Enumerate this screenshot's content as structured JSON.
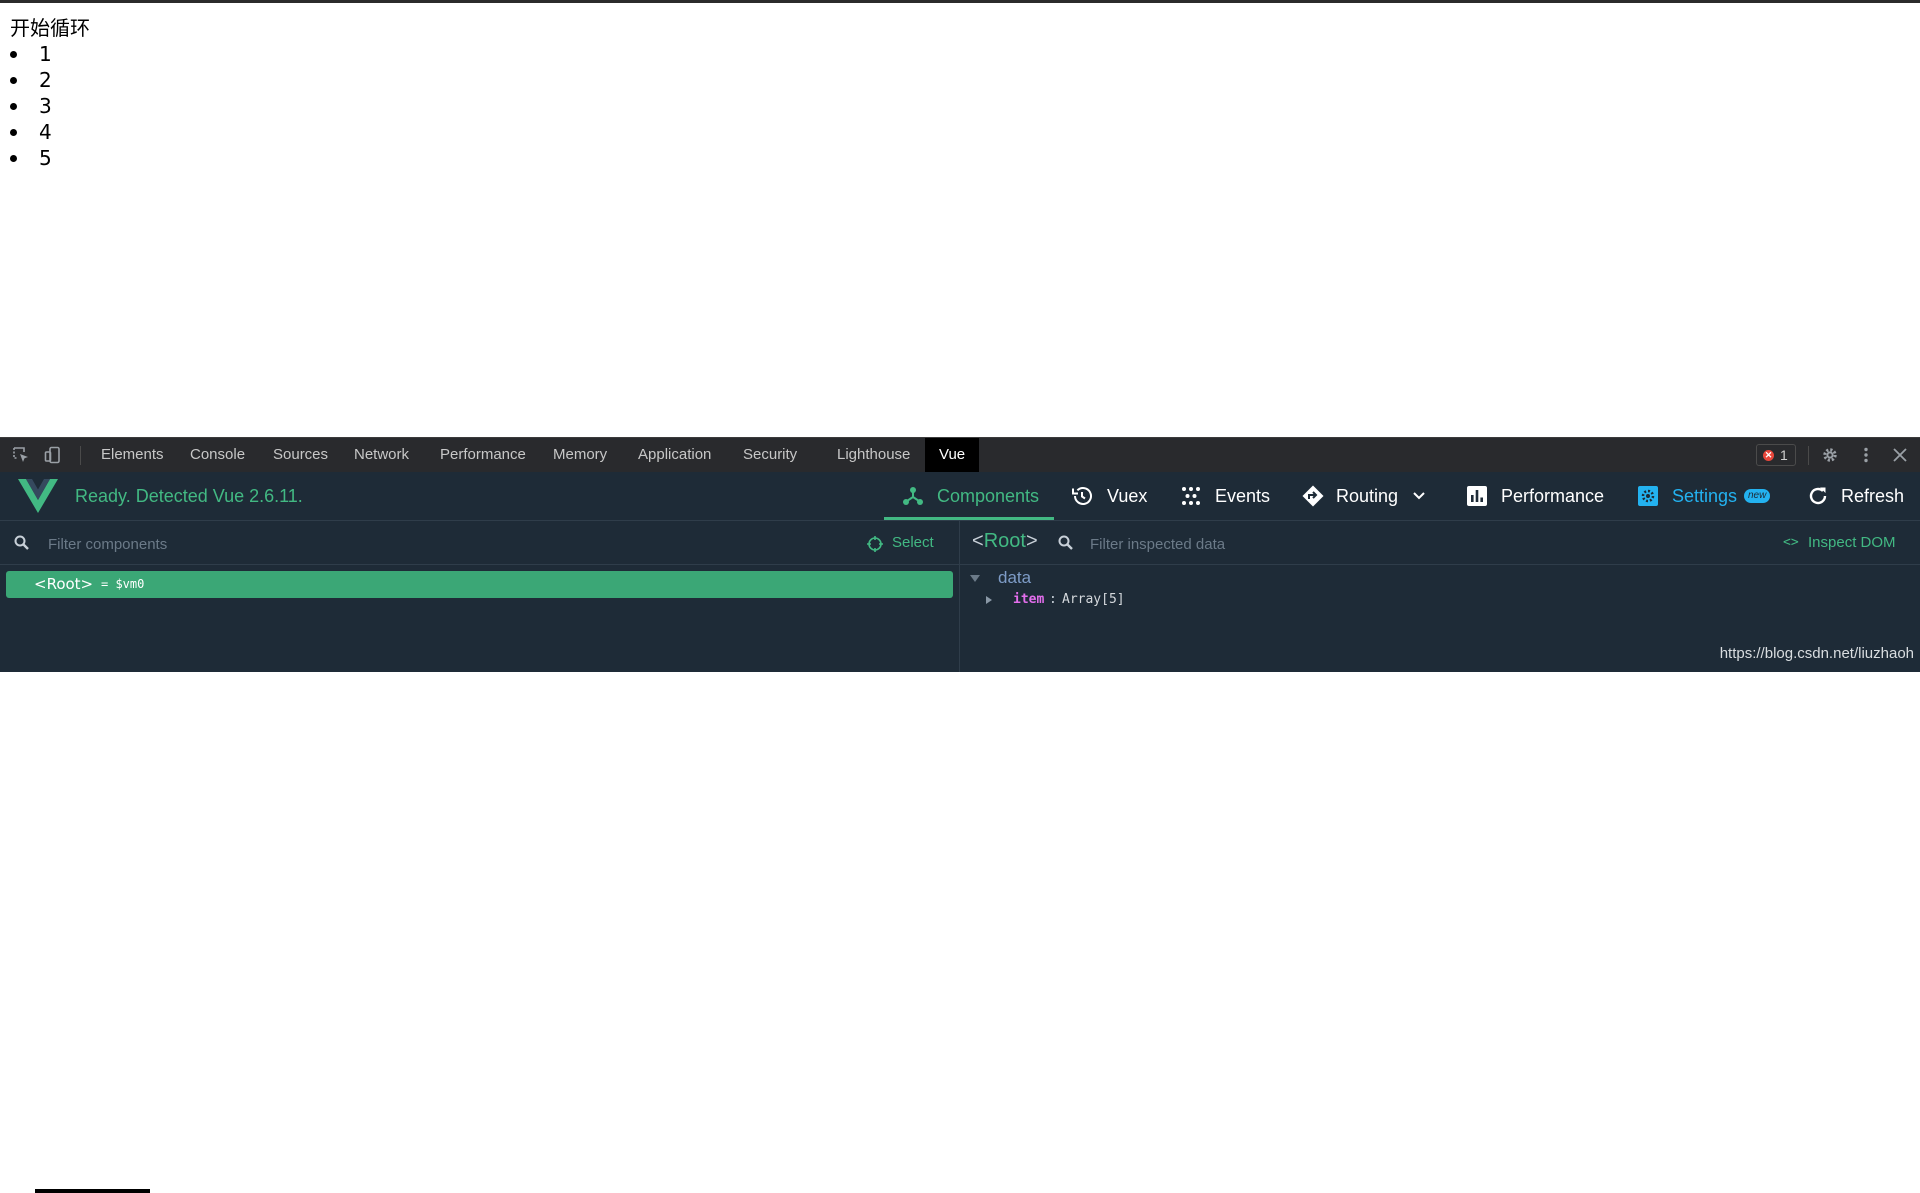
{
  "page": {
    "heading": "开始循环",
    "items": [
      "1",
      "2",
      "3",
      "4",
      "5"
    ]
  },
  "devtools": {
    "tabs": [
      "Elements",
      "Console",
      "Sources",
      "Network",
      "Performance",
      "Memory",
      "Application",
      "Security",
      "Lighthouse",
      "Vue"
    ],
    "active_tab": "Vue",
    "error_count": "1",
    "error_symbol": "✕"
  },
  "vue": {
    "status": "Ready. Detected Vue 2.6.11.",
    "nav": {
      "components": "Components",
      "vuex": "Vuex",
      "events": "Events",
      "routing": "Routing",
      "performance": "Performance",
      "settings": "Settings",
      "new_badge": "new",
      "refresh": "Refresh"
    },
    "active_nav": "Components",
    "components_panel": {
      "filter_placeholder": "Filter components",
      "select_label": "Select",
      "tree": [
        {
          "tag": "<Root>",
          "vm": "= $vm0",
          "selected": true
        }
      ]
    },
    "inspector": {
      "open_bracket": "<",
      "component_name": "Root",
      "close_bracket": ">",
      "filter_placeholder": "Filter inspected data",
      "inspect_dom_icon": "<>",
      "inspect_dom_label": "Inspect DOM",
      "section_title": "data",
      "props": [
        {
          "key": "item",
          "colon": ":",
          "value": "Array[5]"
        }
      ]
    }
  },
  "watermark": "https://blog.csdn.net/liuzhaoh",
  "colors": {
    "vue_green": "#42b983",
    "panel_bg": "#1e2b37",
    "settings_blue": "#23b2f0",
    "key_magenta": "#e36eec"
  }
}
